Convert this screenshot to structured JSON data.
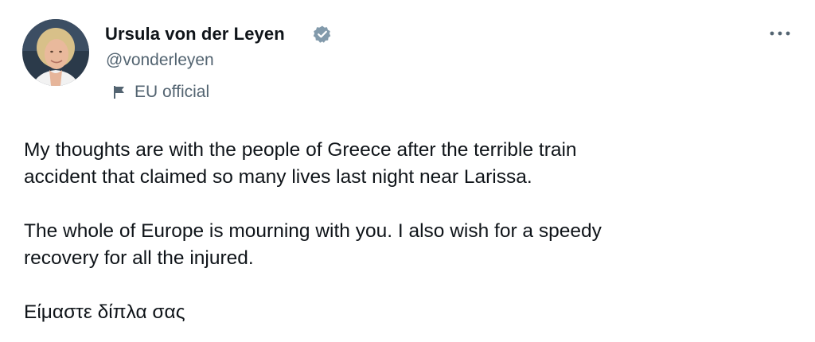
{
  "author": {
    "display_name": "Ursula von der Leyen",
    "handle": "@vonderleyen",
    "affiliation_label": "EU official",
    "verified_icon": "verified-badge-icon",
    "avatar_icon": "profile-photo"
  },
  "menu": {
    "more_icon": "more-horizontal-icon"
  },
  "tweet": {
    "paragraphs": [
      "My thoughts are with the people of Greece after the terrible train\naccident that claimed so many lives last night near Larissa.",
      "The whole of Europe is mourning with you. I also wish for a speedy\nrecovery for all the injured.",
      "Είμαστε δίπλα σας"
    ]
  },
  "colors": {
    "text_primary": "#0f1419",
    "text_secondary": "#536471",
    "verified_badge": "#829aab",
    "background": "#ffffff"
  }
}
